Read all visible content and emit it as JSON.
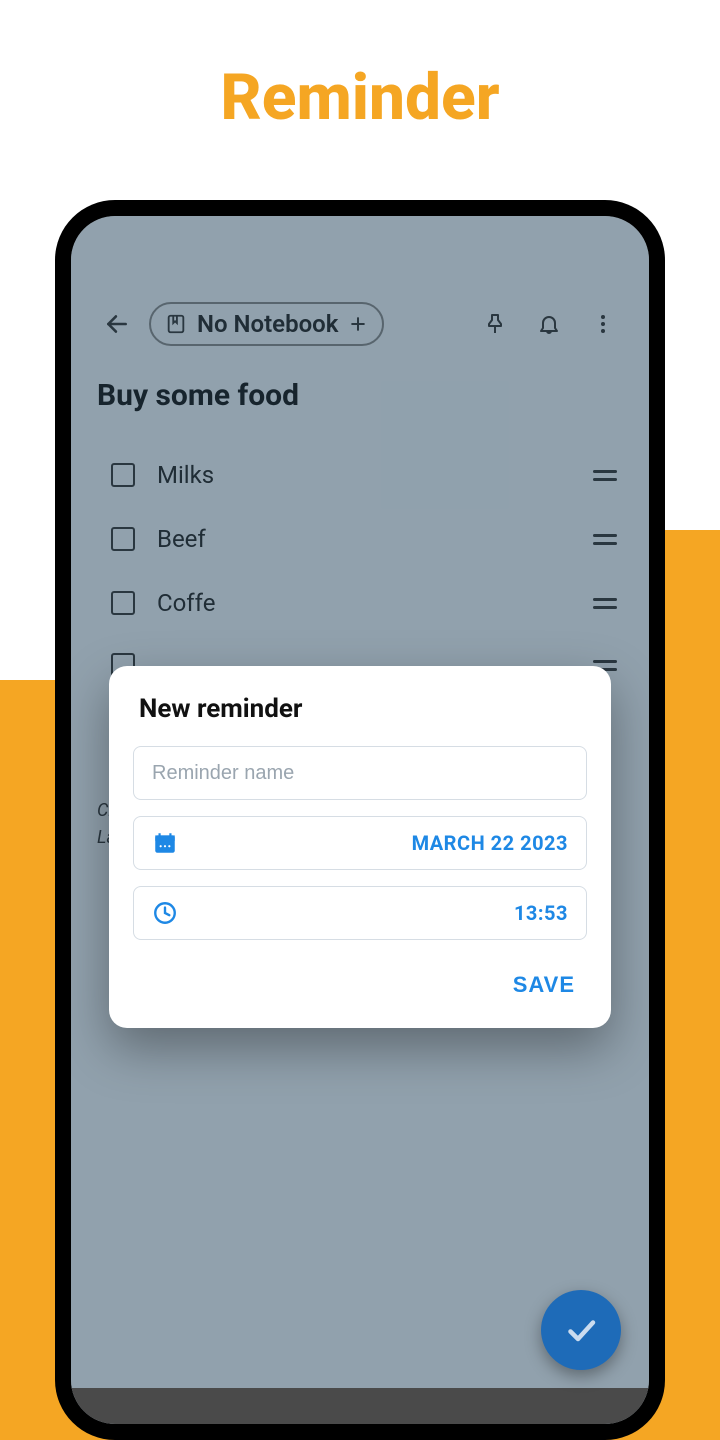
{
  "promo": {
    "title": "Reminder"
  },
  "topbar": {
    "notebook_label": "No Notebook"
  },
  "note": {
    "title": "Buy some food",
    "items": [
      {
        "label": "Milks"
      },
      {
        "label": "Beef"
      },
      {
        "label": "Coffe"
      }
    ],
    "meta_created_prefix": "Cre",
    "meta_last_prefix": "Las"
  },
  "dialog": {
    "title": "New reminder",
    "name_placeholder": "Reminder name",
    "date_value": "MARCH 22 2023",
    "time_value": "13:53",
    "save_label": "SAVE"
  }
}
